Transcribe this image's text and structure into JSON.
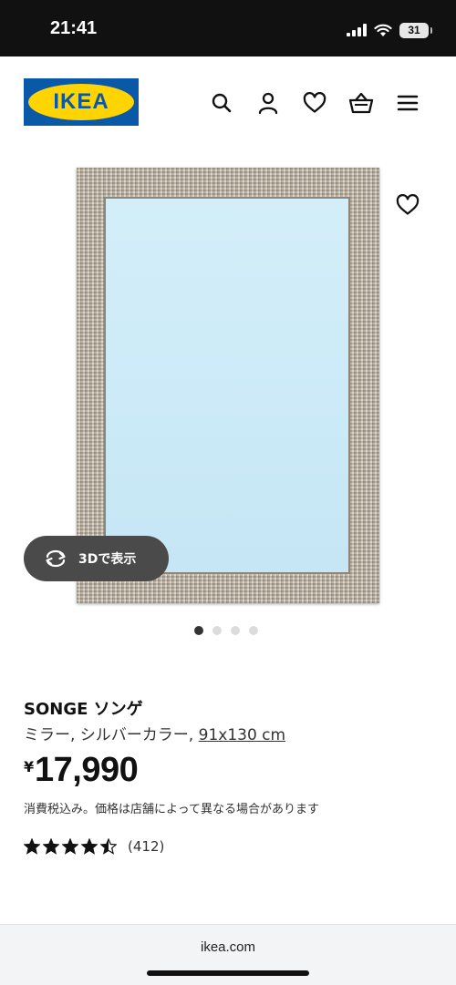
{
  "status_bar": {
    "time": "21:41",
    "battery": "31",
    "icons": [
      "signal-icon",
      "wifi-icon",
      "battery-icon"
    ]
  },
  "header": {
    "logo_text": "IKEA",
    "icons": [
      "search-icon",
      "account-icon",
      "heart-icon",
      "cart-icon",
      "menu-icon"
    ]
  },
  "gallery": {
    "view_3d_label": "3Dで表示",
    "slide_count": 4,
    "active_slide": 1
  },
  "product": {
    "name": "SONGE ソンゲ",
    "description": "ミラー, シルバーカラー, ",
    "size": "91x130 cm",
    "currency": "¥",
    "price": "17,990",
    "tax_note": "消費税込み。価格は店舗によって異なる場合があります",
    "rating": 4.5,
    "review_count": "(412)"
  },
  "browser": {
    "url": "ikea.com"
  },
  "colors": {
    "ikea_blue": "#0a58a8",
    "ikea_yellow": "#ffd400",
    "status_bar": "#111111",
    "pill_button": "#4a4a4a"
  }
}
